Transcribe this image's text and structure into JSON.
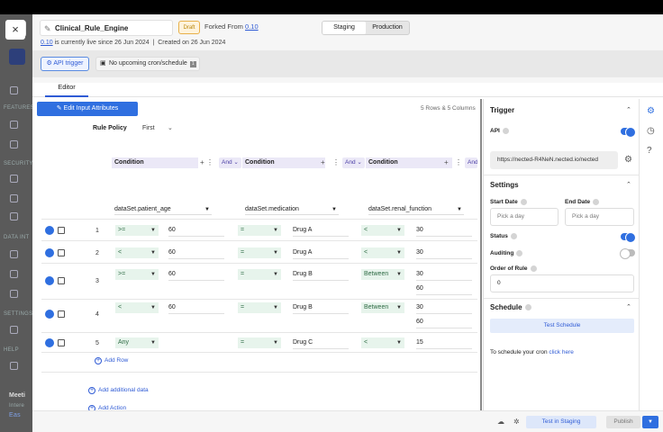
{
  "sidebar": {
    "sections": [
      "FEATURES",
      "SECURITY",
      "DATA INT",
      "SETTINGS",
      "HELP"
    ],
    "footer_title": "Meeti",
    "footer_sub": "Intere",
    "footer_link": "Eas"
  },
  "header": {
    "close": "×",
    "rule_name": "Clinical_Rule_Engine",
    "draft_badge": "Draft",
    "forked_prefix": "Forked From",
    "forked_version": "0.10",
    "env_staging": "Staging",
    "env_production": "Production",
    "live_version": "0.10",
    "live_text": "is currently live since 26 Jun 2024",
    "created_text": "Created on 26 Jun 2024"
  },
  "triggers": {
    "api": "API trigger",
    "cron": "No upcoming cron/schedule",
    "cron_badge": "1"
  },
  "tabs": {
    "editor": "Editor"
  },
  "editor": {
    "edit_attrs": "Edit Input Attributes",
    "dims": "5 Rows & 5 Columns",
    "rule_policy_label": "Rule Policy",
    "rule_policy_value": "First",
    "condition_label": "Condition",
    "and_label": "And",
    "fields": [
      "dataSet.patient_age",
      "dataSet.medication",
      "dataSet.renal_function"
    ],
    "rows": [
      {
        "n": "1",
        "c1op": ">=",
        "c1v": "60",
        "c2op": "=",
        "c2v": "Drug A",
        "c3op": "<",
        "c3v": "30"
      },
      {
        "n": "2",
        "c1op": "<",
        "c1v": "60",
        "c2op": "=",
        "c2v": "Drug A",
        "c3op": "<",
        "c3v": "30"
      },
      {
        "n": "3",
        "c1op": ">=",
        "c1v": "60",
        "c2op": "=",
        "c2v": "Drug B",
        "c3op": "Between",
        "c3v": "30",
        "c3v2": "60"
      },
      {
        "n": "4",
        "c1op": "<",
        "c1v": "60",
        "c2op": "=",
        "c2v": "Drug B",
        "c3op": "Between",
        "c3v": "30",
        "c3v2": "60"
      },
      {
        "n": "5",
        "c1op": "Any",
        "c1v": "",
        "c2op": "=",
        "c2v": "Drug C",
        "c3op": "<",
        "c3v": "15"
      }
    ],
    "add_row": "Add Row",
    "add_data": "Add additional data",
    "add_action": "Add Action"
  },
  "trigger_panel": {
    "title": "Trigger",
    "api_label": "API",
    "api_url": "https://nected-R4NeN.nected.io/nected",
    "settings_title": "Settings",
    "start_date_label": "Start Date",
    "end_date_label": "End Date",
    "date_placeholder": "Pick a day",
    "status_label": "Status",
    "auditing_label": "Auditing",
    "order_label": "Order of Rule",
    "order_value": "0",
    "schedule_title": "Schedule",
    "test_schedule": "Test Schedule",
    "cron_note": "To schedule your cron",
    "cron_link": "click here"
  },
  "footer": {
    "test_in_staging": "Test in Staging",
    "publish": "Publish"
  },
  "colors": {
    "accent": "#2f6fe0",
    "condition_bg": "#ebe8f7",
    "operator_bg": "#e7f4ec"
  }
}
